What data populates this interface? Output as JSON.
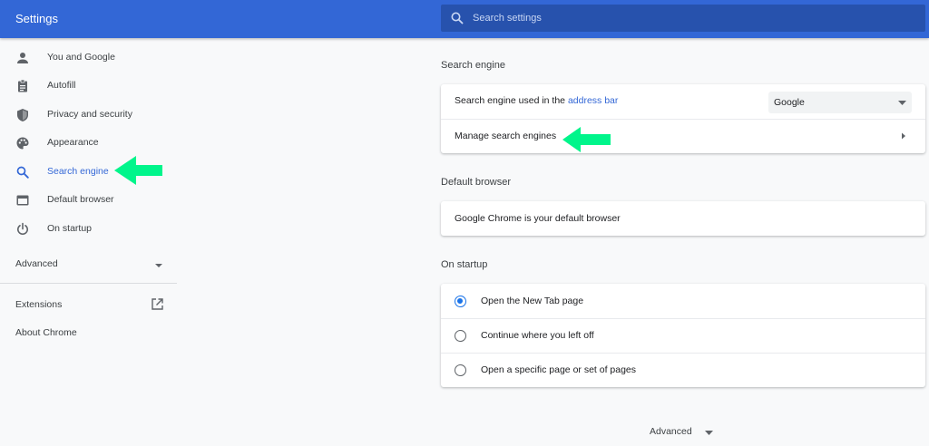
{
  "header": {
    "title": "Settings",
    "search_placeholder": "Search settings"
  },
  "sidebar": {
    "items": [
      {
        "label": "You and Google",
        "icon": "person-icon"
      },
      {
        "label": "Autofill",
        "icon": "clipboard-icon"
      },
      {
        "label": "Privacy and security",
        "icon": "shield-icon"
      },
      {
        "label": "Appearance",
        "icon": "palette-icon"
      },
      {
        "label": "Search engine",
        "icon": "search-icon",
        "active": true
      },
      {
        "label": "Default browser",
        "icon": "browser-window-icon"
      },
      {
        "label": "On startup",
        "icon": "power-icon"
      }
    ],
    "advanced_label": "Advanced",
    "extensions_label": "Extensions",
    "about_label": "About Chrome"
  },
  "search_engine": {
    "title": "Search engine",
    "used_in_prefix": "Search engine used in the ",
    "used_in_link": "address bar",
    "selected_engine": "Google",
    "manage_label": "Manage search engines"
  },
  "default_browser": {
    "title": "Default browser",
    "status": "Google Chrome is your default browser"
  },
  "on_startup": {
    "title": "On startup",
    "options": [
      {
        "label": "Open the New Tab page",
        "selected": true
      },
      {
        "label": "Continue where you left off",
        "selected": false
      },
      {
        "label": "Open a specific page or set of pages",
        "selected": false
      }
    ]
  },
  "footer": {
    "advanced_label": "Advanced"
  },
  "colors": {
    "header": "#3367d6",
    "accent": "#3367d6",
    "annotation_arrow": "#00f58b"
  }
}
